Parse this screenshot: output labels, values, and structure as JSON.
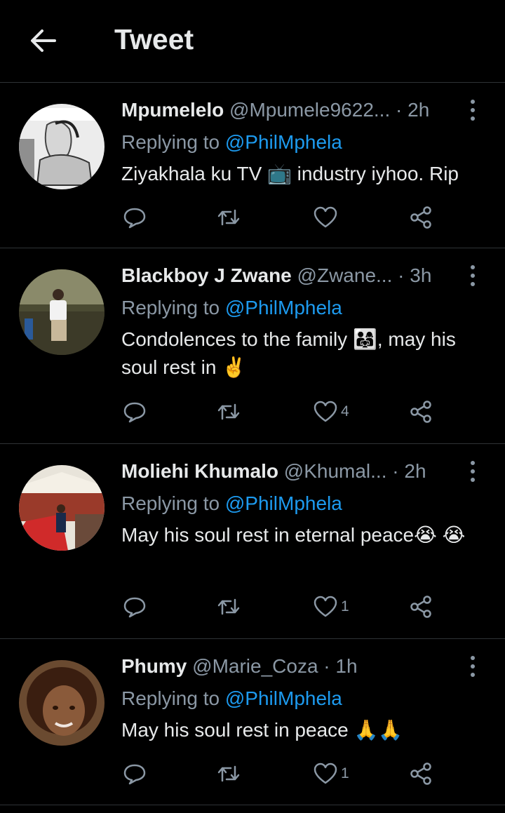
{
  "header": {
    "title": "Tweet",
    "back_icon": "arrow-left-icon"
  },
  "colors": {
    "background": "#000000",
    "text": "#e7e9ea",
    "muted": "#8b98a5",
    "accent": "#1d9bf0",
    "divider": "#2f3336"
  },
  "tweets": [
    {
      "name": "Mpumelelo",
      "handle": "@Mpumele9622...",
      "sep": "·",
      "time": "2h",
      "replying_prefix": "Replying to",
      "replying_to": "@PhilMphela",
      "text": "Ziyakhala ku TV 📺 industry iyhoo. Rip",
      "likes": ""
    },
    {
      "name": "Blackboy J Zwane",
      "handle": "@Zwane...",
      "sep": "·",
      "time": "3h",
      "replying_prefix": "Replying to",
      "replying_to": "@PhilMphela",
      "text": "Condolences to the family 👨‍👩‍👧, may his soul rest in ✌️",
      "likes": "4"
    },
    {
      "name": "Moliehi Khumalo",
      "handle": "@Khumal...",
      "sep": "·",
      "time": "2h",
      "replying_prefix": "Replying to",
      "replying_to": "@PhilMphela",
      "text": "May his soul rest in eternal peace😭 😭",
      "likes": "1"
    },
    {
      "name": "Phumy",
      "handle": "@Marie_Coza",
      "sep": "·",
      "time": "1h",
      "replying_prefix": "Replying to",
      "replying_to": "@PhilMphela",
      "text": "May his soul rest in peace 🙏🙏",
      "likes": "1"
    }
  ]
}
